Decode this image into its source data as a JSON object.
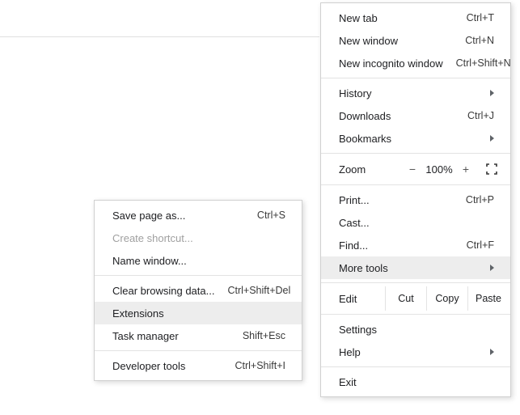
{
  "mainMenu": {
    "newTab": {
      "label": "New tab",
      "shortcut": "Ctrl+T"
    },
    "newWindow": {
      "label": "New window",
      "shortcut": "Ctrl+N"
    },
    "newIncognito": {
      "label": "New incognito window",
      "shortcut": "Ctrl+Shift+N"
    },
    "history": {
      "label": "History"
    },
    "downloads": {
      "label": "Downloads",
      "shortcut": "Ctrl+J"
    },
    "bookmarks": {
      "label": "Bookmarks"
    },
    "zoom": {
      "label": "Zoom",
      "minus": "−",
      "percent": "100%",
      "plus": "+"
    },
    "print": {
      "label": "Print...",
      "shortcut": "Ctrl+P"
    },
    "cast": {
      "label": "Cast..."
    },
    "find": {
      "label": "Find...",
      "shortcut": "Ctrl+F"
    },
    "moreTools": {
      "label": "More tools"
    },
    "edit": {
      "label": "Edit",
      "cut": "Cut",
      "copy": "Copy",
      "paste": "Paste"
    },
    "settings": {
      "label": "Settings"
    },
    "help": {
      "label": "Help"
    },
    "exit": {
      "label": "Exit"
    }
  },
  "subMenu": {
    "savePageAs": {
      "label": "Save page as...",
      "shortcut": "Ctrl+S"
    },
    "createShortcut": {
      "label": "Create shortcut..."
    },
    "nameWindow": {
      "label": "Name window..."
    },
    "clearBrowsingData": {
      "label": "Clear browsing data...",
      "shortcut": "Ctrl+Shift+Del"
    },
    "extensions": {
      "label": "Extensions"
    },
    "taskManager": {
      "label": "Task manager",
      "shortcut": "Shift+Esc"
    },
    "developerTools": {
      "label": "Developer tools",
      "shortcut": "Ctrl+Shift+I"
    }
  }
}
